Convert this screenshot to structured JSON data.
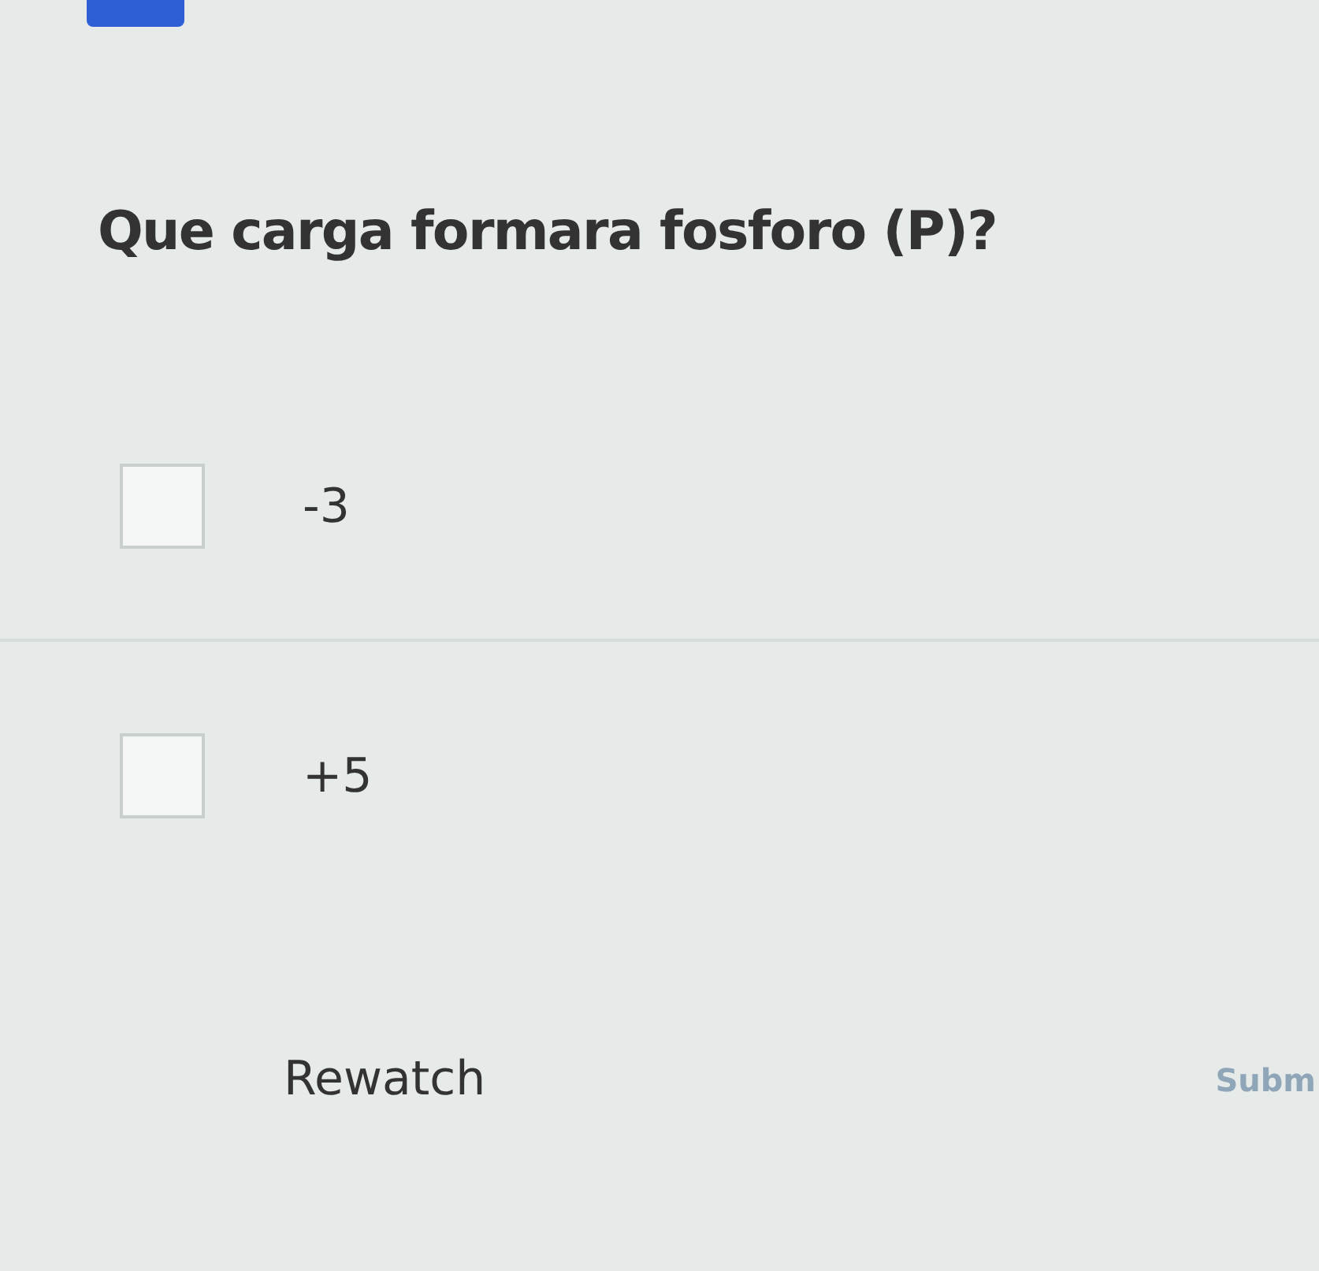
{
  "question": "Que carga formara fosforo (P)?",
  "options": [
    {
      "label": "-3",
      "checked": false
    },
    {
      "label": "+5",
      "checked": false
    }
  ],
  "rewatch": "Rewatch",
  "submit": {
    "label": "Subm",
    "disabled": true
  }
}
